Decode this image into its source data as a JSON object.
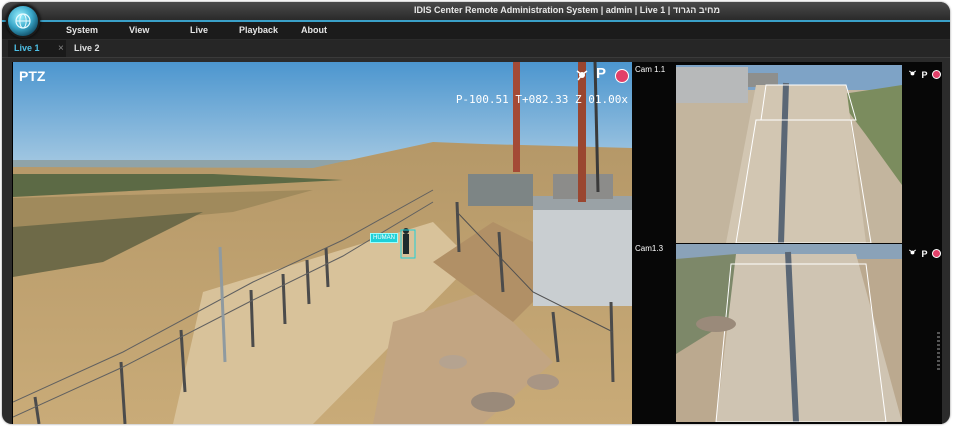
{
  "window": {
    "title": "IDIS Center Remote Administration System | admin | Live 1 | מחיב הגרוד"
  },
  "menu": {
    "items": [
      "System",
      "View",
      "Live",
      "Playback",
      "About"
    ]
  },
  "tabs": [
    {
      "label": "Live 1",
      "active": true
    },
    {
      "label": "Live 2",
      "active": false
    }
  ],
  "tab_close_glyph": "×",
  "main_camera": {
    "label": "PTZ",
    "ptz_readout": "P-100.51 T+082.33 Z 01.00x",
    "p_icon": "P",
    "detection_tag": "HUMAN",
    "icons": [
      "ptz-icon",
      "p-icon",
      "record-icon"
    ]
  },
  "side_cameras": [
    {
      "label": "Cam 1.1",
      "icon_text": "P",
      "icons": [
        "ptz-icon",
        "p-icon",
        "record-icon"
      ]
    },
    {
      "label": "Cam1.3",
      "icon_text": "P",
      "icons": [
        "ptz-icon",
        "p-icon",
        "record-icon"
      ]
    }
  ],
  "colors": {
    "accent": "#4ec0e6",
    "record": "#e24069",
    "background": "#2b2b2b",
    "detection": "#1ed0d8"
  }
}
